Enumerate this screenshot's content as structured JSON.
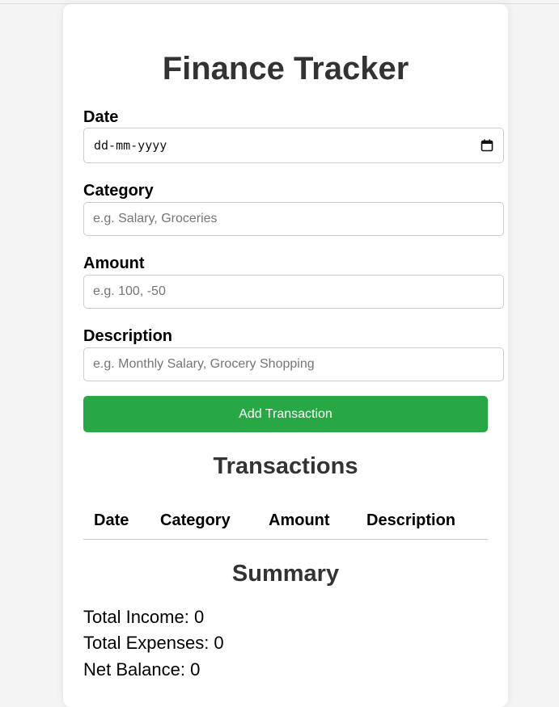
{
  "app": {
    "title": "Finance Tracker"
  },
  "form": {
    "date": {
      "label": "Date",
      "value_display": "dd-mm-yyyy"
    },
    "category": {
      "label": "Category",
      "placeholder": "e.g. Salary, Groceries",
      "value": ""
    },
    "amount": {
      "label": "Amount",
      "placeholder": "e.g. 100, -50",
      "value": ""
    },
    "description": {
      "label": "Description",
      "placeholder": "e.g. Monthly Salary, Grocery Shopping",
      "value": ""
    },
    "submit_label": "Add Transaction"
  },
  "transactions": {
    "heading": "Transactions",
    "columns": [
      "Date",
      "Category",
      "Amount",
      "Description"
    ],
    "rows": []
  },
  "summary": {
    "heading": "Summary",
    "total_income": "Total Income: 0",
    "total_expenses": "Total Expenses: 0",
    "net_balance": "Net Balance: 0"
  },
  "colors": {
    "accent": "#28a745",
    "heading": "#333333",
    "background": "#f4f4f4"
  },
  "icons": {
    "date_picker": "calendar-icon"
  }
}
